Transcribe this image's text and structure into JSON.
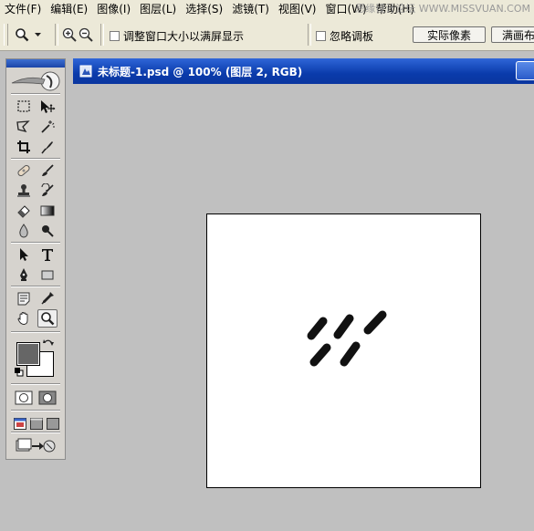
{
  "menu": {
    "items": [
      "文件(F)",
      "编辑(E)",
      "图像(I)",
      "图层(L)",
      "选择(S)",
      "滤镜(T)",
      "视图(V)",
      "窗口(W)",
      "帮助(H)"
    ],
    "watermark": "思缘设计论坛 WWW.MISSVUAN.COM"
  },
  "options_bar": {
    "tool_preset_icon": "zoom-icon",
    "zoom_in_icon": "zoom-in-icon",
    "zoom_out_icon": "zoom-out-icon",
    "resize_windows_label": "调整窗口大小以满屏显示",
    "resize_windows_checked": false,
    "ignore_palettes_label": "忽略调板",
    "ignore_palettes_checked": false,
    "actual_pixels_label": "实际像素",
    "fit_screen_label": "满画布"
  },
  "toolbox": {
    "foreground_color": "#666666",
    "background_color": "#ffffff",
    "active_tool": "zoom-tool"
  },
  "document": {
    "title": "未标题-1.psd @ 100% (图层 2, RGB)",
    "title_bar_color": "#0a3bab",
    "canvas_color": "#ffffff",
    "workspace_color": "#c0c0c0"
  }
}
